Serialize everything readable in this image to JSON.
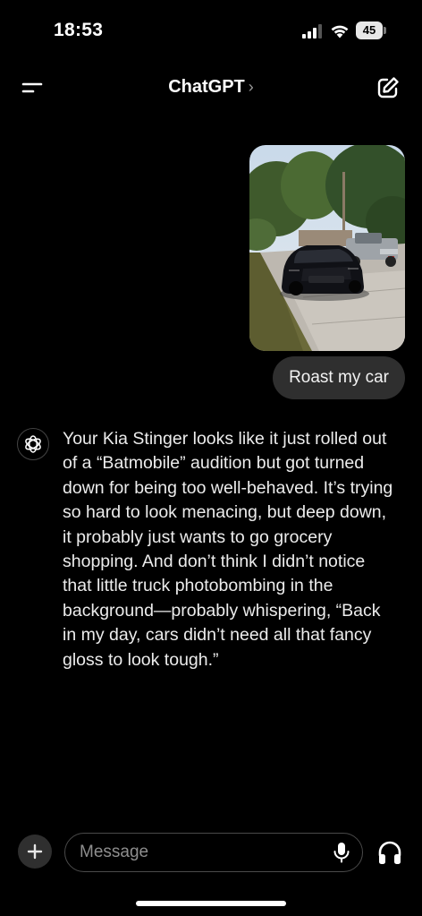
{
  "status_bar": {
    "time": "18:53",
    "battery_level": "45",
    "icons": [
      "signal-icon",
      "wifi-icon",
      "battery-icon"
    ]
  },
  "header": {
    "title": "ChatGPT",
    "chevron": "›",
    "left_icon": "menu-icon",
    "right_icon": "new-chat-icon"
  },
  "conversation": {
    "user_image": "car-photo",
    "user_message": "Roast my car",
    "assistant_icon": "openai-logo-icon",
    "assistant_message": "Your Kia Stinger looks like it just rolled out of a “Batmobile” audition but got turned down for being too well-behaved. It’s trying so hard to look menacing, but deep down, it probably just wants to go grocery shopping. And don’t think I didn’t notice that little truck photobombing in the background—probably whispering, “Back in my day, cars didn’t need all that fancy gloss to look tough.”"
  },
  "composer": {
    "placeholder": "Message",
    "icons": [
      "plus-icon",
      "mic-icon",
      "headphones-icon"
    ]
  },
  "colors": {
    "background": "#000000",
    "bubble": "#2f2f2f",
    "text": "#ececec",
    "placeholder": "#8e8e8e"
  }
}
